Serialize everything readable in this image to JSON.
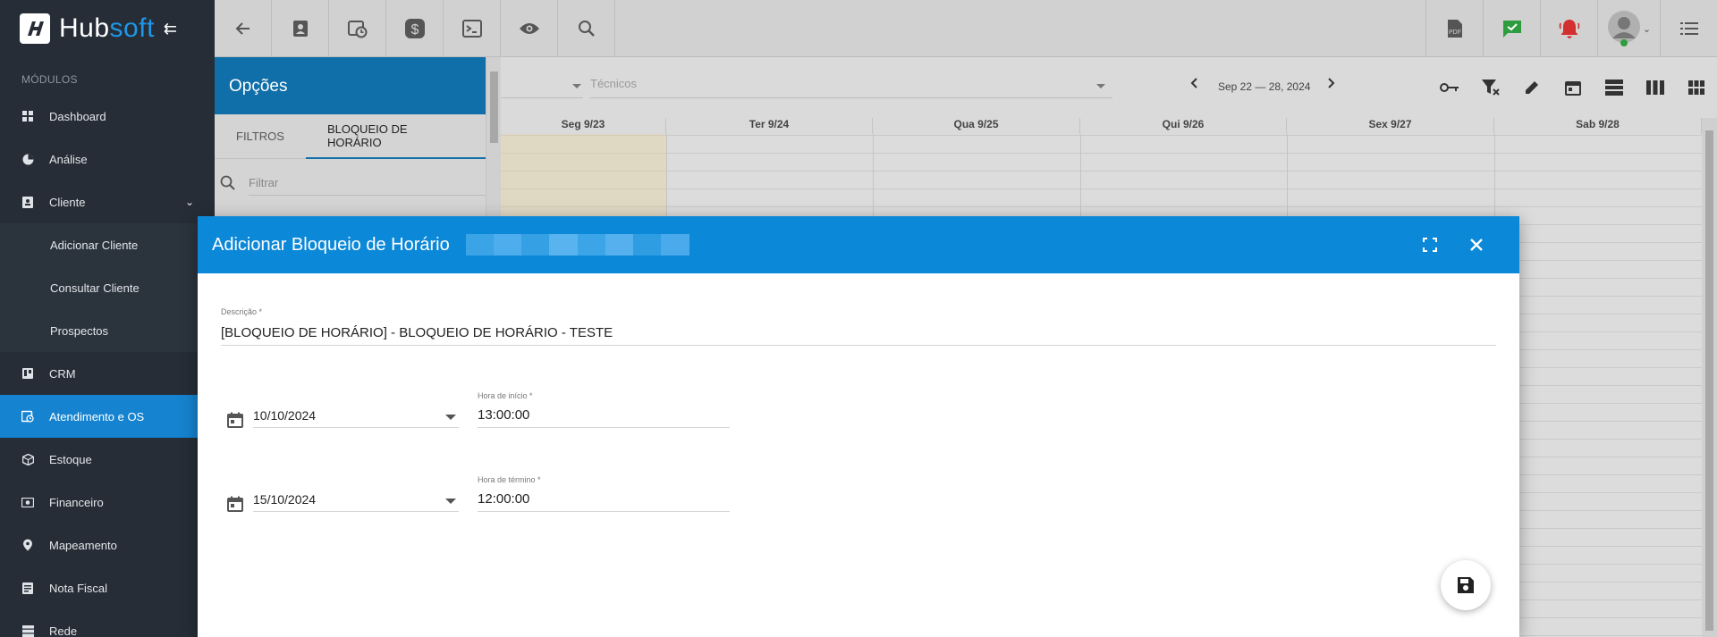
{
  "app": {
    "logo_text_1": "Hub",
    "logo_text_2": "soft"
  },
  "sidebar": {
    "section_title": "MÓDULOS",
    "items": [
      {
        "label": "Dashboard",
        "icon": "grid-icon"
      },
      {
        "label": "Análise",
        "icon": "pie-chart-icon"
      },
      {
        "label": "Cliente",
        "icon": "contact-icon"
      },
      {
        "label": "Adicionar Cliente"
      },
      {
        "label": "Consultar Cliente"
      },
      {
        "label": "Prospectos"
      },
      {
        "label": "CRM",
        "icon": "trello-icon"
      },
      {
        "label": "Atendimento e OS",
        "icon": "calendar-clock-icon"
      },
      {
        "label": "Estoque",
        "icon": "box-icon"
      },
      {
        "label": "Financeiro",
        "icon": "money-icon"
      },
      {
        "label": "Mapeamento",
        "icon": "map-pin-icon"
      },
      {
        "label": "Nota Fiscal",
        "icon": "receipt-icon"
      },
      {
        "label": "Rede",
        "icon": "server-icon"
      }
    ]
  },
  "options": {
    "title": "Opções",
    "tabs": [
      "FILTROS",
      "BLOQUEIO DE HORÁRIO"
    ],
    "filter_placeholder": "Filtrar"
  },
  "calendar": {
    "tecnicos_placeholder": "Técnicos",
    "range": "Sep 22 — 28, 2024",
    "days": [
      "Seg 9/23",
      "Ter 9/24",
      "Qua 9/25",
      "Qui 9/26",
      "Sex 9/27",
      "Sab 9/28"
    ]
  },
  "modal": {
    "title": "Adicionar Bloqueio de Horário",
    "descricao_label": "Descrição *",
    "descricao_value": "[BLOQUEIO DE HORÁRIO] - BLOQUEIO DE HORÁRIO - TESTE",
    "start_date": "10/10/2024",
    "hora_inicio_label": "Hora de início *",
    "hora_inicio_value": "13:00:00",
    "end_date": "15/10/2024",
    "hora_termino_label": "Hora de término *",
    "hora_termino_value": "12:00:00"
  },
  "colors": {
    "primary": "#0c88d8",
    "sidebar_bg": "#262d36",
    "active": "#1583cf",
    "alert_red": "#d32f2f",
    "green": "#2e9d3f"
  }
}
